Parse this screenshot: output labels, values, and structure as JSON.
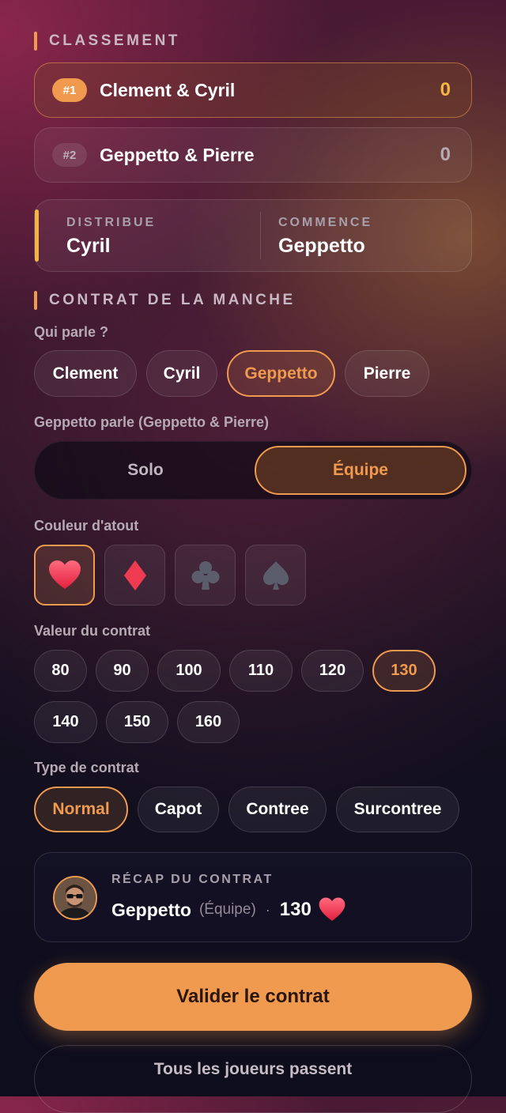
{
  "classement": {
    "title": "CLASSEMENT",
    "teams": [
      {
        "rank": "#1",
        "name": "Clement & Cyril",
        "score": "0"
      },
      {
        "rank": "#2",
        "name": "Geppetto & Pierre",
        "score": "0"
      }
    ]
  },
  "deal": {
    "distribue_label": "DISTRIBUE",
    "distribue_value": "Cyril",
    "commence_label": "COMMENCE",
    "commence_value": "Geppetto"
  },
  "contrat": {
    "title": "CONTRAT DE LA MANCHE",
    "qui_parle_label": "Qui parle ?",
    "players": [
      "Clement",
      "Cyril",
      "Geppetto",
      "Pierre"
    ],
    "selected_player": "Geppetto",
    "speaker_label": "Geppetto parle (Geppetto & Pierre)",
    "mode_options": [
      "Solo",
      "Équipe"
    ],
    "selected_mode": "Équipe",
    "couleur_label": "Couleur d'atout",
    "suits": [
      "heart-icon",
      "diamond-icon",
      "club-icon",
      "spade-icon"
    ],
    "selected_suit": "heart-icon",
    "suit_colors": {
      "heart": "#ef3b52",
      "diamond": "#ef3b52",
      "club": "#5b5d6b",
      "spade": "#5b5d6b"
    },
    "valeur_label": "Valeur du contrat",
    "values": [
      "80",
      "90",
      "100",
      "110",
      "120",
      "130",
      "140",
      "150",
      "160"
    ],
    "selected_value": "130",
    "type_label": "Type de contrat",
    "types": [
      "Normal",
      "Capot",
      "Contree",
      "Surcontree"
    ],
    "selected_type": "Normal"
  },
  "recap": {
    "title": "RÉCAP DU CONTRAT",
    "player": "Geppetto",
    "mode": "(Équipe)",
    "separator": "·",
    "value": "130",
    "suit_icon": "heart-icon"
  },
  "actions": {
    "validate": "Valider le contrat",
    "pass": "Tous les joueurs passent"
  },
  "colors": {
    "accent": "#ef9a4e",
    "score_gold": "#f5b642"
  }
}
